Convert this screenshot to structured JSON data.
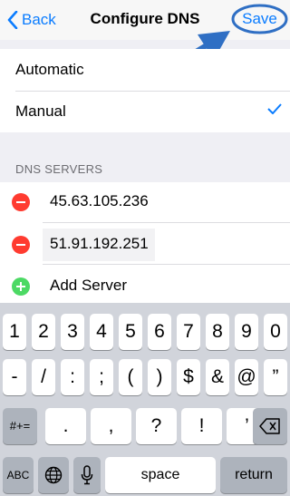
{
  "nav": {
    "back_label": "Back",
    "title": "Configure DNS",
    "save_label": "Save"
  },
  "mode": {
    "options": [
      {
        "label": "Automatic",
        "selected": false
      },
      {
        "label": "Manual",
        "selected": true
      }
    ]
  },
  "dns": {
    "header": "DNS SERVERS",
    "servers": [
      "45.63.105.236",
      "51.91.192.251"
    ],
    "add_label": "Add Server"
  },
  "keyboard": {
    "row1": [
      "1",
      "2",
      "3",
      "4",
      "5",
      "6",
      "7",
      "8",
      "9",
      "0"
    ],
    "row2": [
      "-",
      "/",
      ":",
      ";",
      "(",
      ")",
      "$",
      "&",
      "@",
      "”"
    ],
    "row3_left": "#+=",
    "row3": [
      ".",
      ",",
      "?",
      "!",
      "’"
    ],
    "abc_label": "ABC",
    "space_label": "space",
    "return_label": "return"
  },
  "colors": {
    "accent": "#0a7cff",
    "remove": "#ff3b30",
    "add": "#4cd964"
  }
}
